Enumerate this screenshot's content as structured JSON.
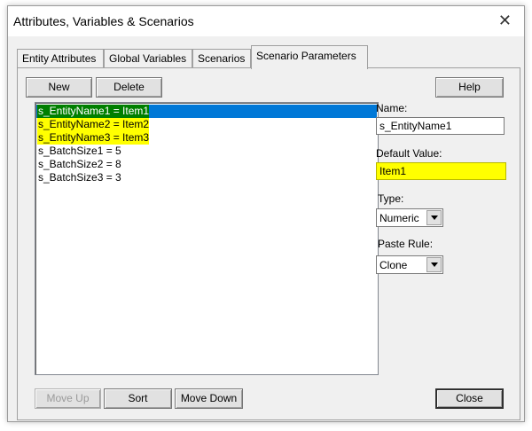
{
  "window": {
    "title": "Attributes, Variables & Scenarios",
    "close_glyph": "✕"
  },
  "tabs": [
    {
      "label": "Entity Attributes",
      "active": false
    },
    {
      "label": "Global Variables",
      "active": false
    },
    {
      "label": "Scenarios",
      "active": false
    },
    {
      "label": "Scenario Parameters",
      "active": true
    }
  ],
  "toolbar": {
    "new_label": "New",
    "delete_label": "Delete",
    "help_label": "Help"
  },
  "list": {
    "items": [
      {
        "text": "s_EntityName1 = Item1",
        "highlight": "green-selected"
      },
      {
        "text": "s_EntityName2 = Item2",
        "highlight": "yellow"
      },
      {
        "text": "s_EntityName3 = Item3",
        "highlight": "yellow"
      },
      {
        "text": "s_BatchSize1 = 5",
        "highlight": "none"
      },
      {
        "text": "s_BatchSize2 = 8",
        "highlight": "none"
      },
      {
        "text": "s_BatchSize3 = 3",
        "highlight": "none"
      }
    ]
  },
  "fields": {
    "name_label": "Name:",
    "name_value": "s_EntityName1",
    "default_label": "Default Value:",
    "default_value": "Item1",
    "type_label": "Type:",
    "type_value": "Numeric",
    "paste_label": "Paste Rule:",
    "paste_value": "Clone"
  },
  "bottom": {
    "move_up_label": "Move Up",
    "sort_label": "Sort",
    "move_down_label": "Move Down",
    "close_label": "Close"
  },
  "colors": {
    "highlight_yellow": "#ffff00",
    "selected_green": "#007f00",
    "selection_blue": "#0078d7"
  },
  "icons": {
    "dropdown": "chevron-down-icon",
    "close": "close-icon"
  }
}
